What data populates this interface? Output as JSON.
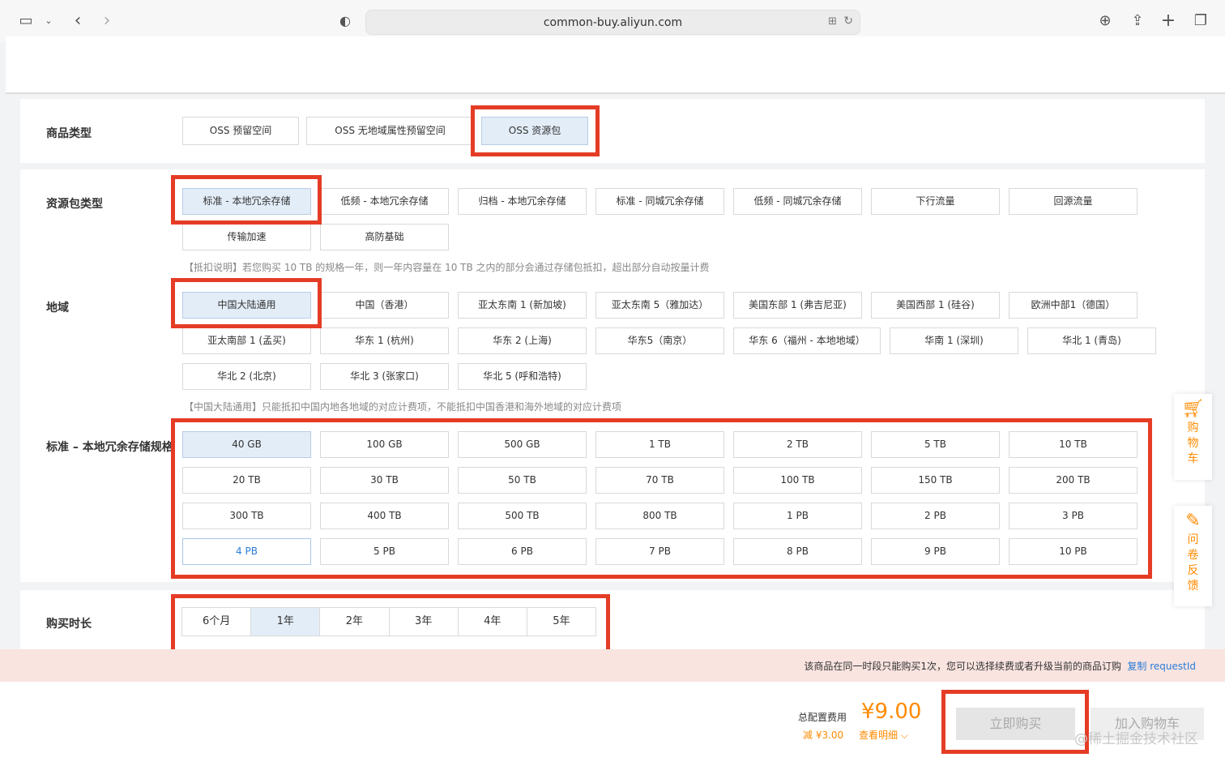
{
  "browser": {
    "url": "common-buy.aliyun.com"
  },
  "product_type": {
    "label": "商品类型",
    "options": [
      "OSS 预留空间",
      "OSS 无地域属性预留空间",
      "OSS 资源包"
    ]
  },
  "package_type": {
    "label": "资源包类型",
    "options": [
      "标准 - 本地冗余存储",
      "低频 - 本地冗余存储",
      "归档 - 本地冗余存储",
      "标准 - 同城冗余存储",
      "低频 - 同城冗余存储",
      "下行流量",
      "回源流量",
      "传输加速",
      "高防基础"
    ],
    "note": "【抵扣说明】若您购买 10 TB 的规格一年，则一年内容量在 10 TB 之内的部分会通过存储包抵扣，超出部分自动按量计费"
  },
  "region": {
    "label": "地域",
    "options": [
      "中国大陆通用",
      "中国（香港）",
      "亚太东南 1 (新加坡)",
      "亚太东南 5（雅加达）",
      "美国东部 1 (弗吉尼亚)",
      "美国西部 1 (硅谷)",
      "欧洲中部1（德国）",
      "亚太南部 1 (孟买)",
      "华东 1 (杭州)",
      "华东 2 (上海)",
      "华东5（南京）",
      "华东 6（福州 - 本地地域）",
      "华南 1 (深圳)",
      "华北 1 (青岛)",
      "华北 2 (北京)",
      "华北 3 (张家口)",
      "华北 5 (呼和浩特)"
    ],
    "note": "【中国大陆通用】只能抵扣中国内地各地域的对应计费项，不能抵扣中国香港和海外地域的对应计费项"
  },
  "spec": {
    "label": "标准 – 本地冗余存储规格",
    "options": [
      "40 GB",
      "100 GB",
      "500 GB",
      "1 TB",
      "2 TB",
      "5 TB",
      "10 TB",
      "20 TB",
      "30 TB",
      "50 TB",
      "70 TB",
      "100 TB",
      "150 TB",
      "200 TB",
      "300 TB",
      "400 TB",
      "500 TB",
      "800 TB",
      "1 PB",
      "2 PB",
      "3 PB",
      "4 PB",
      "5 PB",
      "6 PB",
      "7 PB",
      "8 PB",
      "9 PB",
      "10 PB"
    ]
  },
  "duration": {
    "label": "购买时长",
    "options": [
      "6个月",
      "1年",
      "2年",
      "3年",
      "4年",
      "5年"
    ]
  },
  "warning": {
    "message": "该商品在同一时段只能购买1次，您可以选择续费或者升级当前的商品订购",
    "link": "复制 requestId"
  },
  "footer": {
    "total_label": "总配置费用",
    "price": "¥9.00",
    "discount": "减 ¥3.00",
    "detail": "查看明细",
    "buy": "立即购买",
    "add_cart": "加入购物车",
    "watermark": "@稀土掘金技术社区"
  },
  "sidebar": {
    "cart": "购物车",
    "survey": "问卷反馈"
  },
  "colors": {
    "highlight": "#e53c26",
    "accent": "#ff8a00",
    "selected": "#e3edf8",
    "link": "#2a7dd8"
  }
}
